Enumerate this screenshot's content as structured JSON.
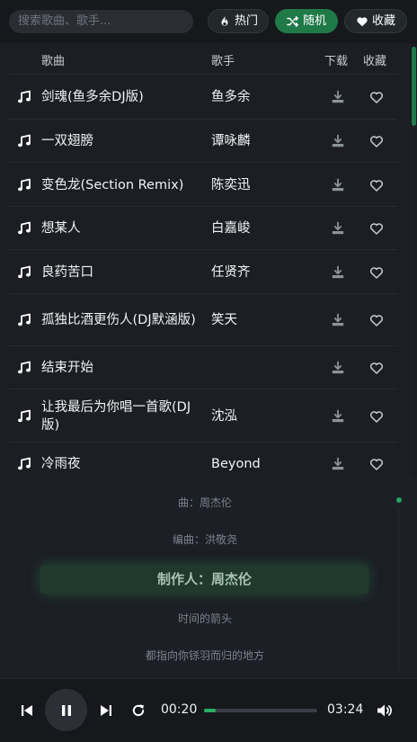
{
  "search": {
    "placeholder": "搜索歌曲、歌手..."
  },
  "filters": [
    {
      "label": "热门",
      "icon": "fire-icon",
      "active": false
    },
    {
      "label": "随机",
      "icon": "shuffle-icon",
      "active": true
    },
    {
      "label": "收藏",
      "icon": "heart-icon",
      "active": false
    }
  ],
  "table": {
    "headers": {
      "song": "歌曲",
      "artist": "歌手",
      "download": "下载",
      "favorite": "收藏"
    },
    "rows": [
      {
        "title": "剑魂(鱼多余DJ版)",
        "artist": "鱼多余"
      },
      {
        "title": "一双翅膀",
        "artist": "谭咏麟"
      },
      {
        "title": "变色龙(Section Remix)",
        "artist": "陈奕迅"
      },
      {
        "title": "想某人",
        "artist": "白嘉峻"
      },
      {
        "title": "良药苦口",
        "artist": "任贤齐"
      },
      {
        "title": "孤独比酒更伤人(DJ默涵版)",
        "artist": "笑天"
      },
      {
        "title": "结束开始",
        "artist": ""
      },
      {
        "title": "让我最后为你唱一首歌(DJ版)",
        "artist": "沈泓"
      },
      {
        "title": "冷雨夜",
        "artist": "Beyond"
      }
    ]
  },
  "lyrics": {
    "lines": [
      "曲：周杰伦",
      "编曲：洪敬尧",
      "制作人：周杰伦",
      "时间的箭头",
      "都指向你铩羽而归的地方"
    ],
    "active_index": 2
  },
  "player": {
    "current_time": "00:20",
    "total_time": "03:24",
    "progress_fraction": 0.1,
    "is_playing": true
  },
  "colors": {
    "accent": "#1f7a48",
    "background": "#15171b",
    "progress": "#2bb067"
  }
}
